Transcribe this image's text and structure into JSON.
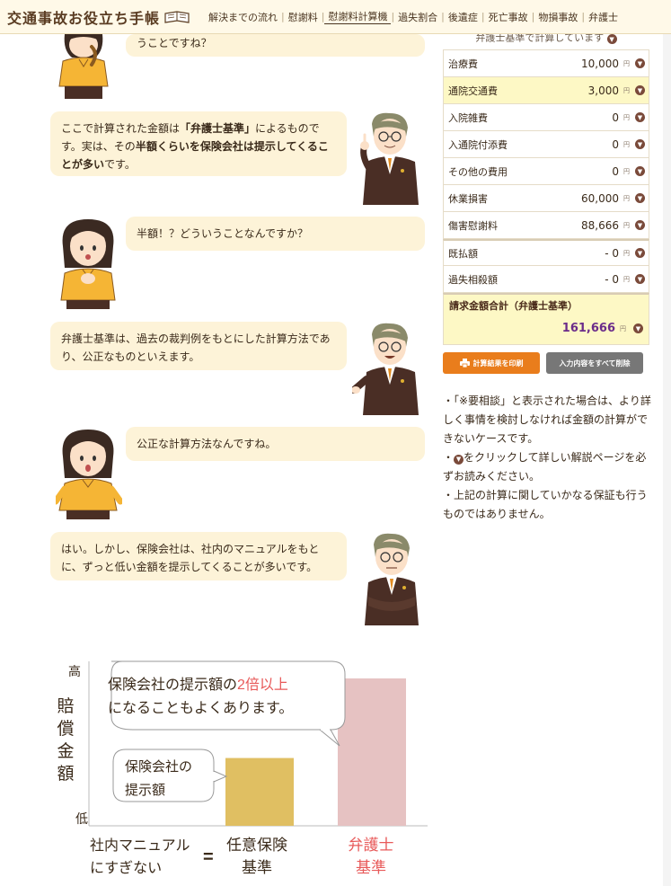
{
  "header": {
    "logo_text": "交通事故お役立ち手帳",
    "nav": [
      {
        "label": "解決までの流れ"
      },
      {
        "label": "慰謝料"
      },
      {
        "label": "慰謝料計算機"
      },
      {
        "label": "過失割合"
      },
      {
        "label": "後遺症"
      },
      {
        "label": "死亡事故"
      },
      {
        "label": "物損事故"
      },
      {
        "label": "弁護士"
      }
    ]
  },
  "conversation": {
    "msg1": "うことですね？",
    "msg2_pre": "ここで計算された金額は",
    "msg2_b1": "「弁護士基準」",
    "msg2_mid": "によるものです。実は、その",
    "msg2_b2": "半額くらいを保険会社は提示してくることが多い",
    "msg2_post": "です。",
    "msg3": "半額！？どういうことなんですか？",
    "msg4": "弁護士基準は、過去の裁判例をもとにした計算方法であり、公正なものといえます。",
    "msg5": "公正な計算方法なんですね。",
    "msg6": "はい。しかし、保険会社は、社内のマニュアルをもとに、ずっと低い金額を提示してくることが多いです。"
  },
  "chart_data": {
    "type": "bar",
    "categories": [
      "任意保険基準",
      "弁護士基準"
    ],
    "values": [
      0.46,
      1.0
    ],
    "ylabel": "賠償金額",
    "y_top_label": "高",
    "y_bottom_label": "低",
    "bar_colors": [
      "#e0bf62",
      "#e6c2c2"
    ],
    "callout_big_1": "保険会社の提示額の",
    "callout_big_emph": "2倍以上",
    "callout_big_2": "になることもよくあります。",
    "callout_small_1": "保険会社の",
    "callout_small_2": "提示額",
    "xlabel_left_1": "社内マニュアル",
    "xlabel_left_2": "にすぎない",
    "equals": "=",
    "cat1_line1": "任意保険",
    "cat1_line2": "基準",
    "cat2_line1": "弁護士",
    "cat2_line2": "基準",
    "emph_color": "#e85a5a"
  },
  "panel": {
    "top_note": "弁護士基準で計算しています",
    "unit": "円",
    "rows": [
      {
        "label": "治療費",
        "value": "10,000"
      },
      {
        "label": "通院交通費",
        "value": "3,000"
      },
      {
        "label": "入院雑費",
        "value": "0"
      },
      {
        "label": "入通院付添費",
        "value": "0"
      },
      {
        "label": "その他の費用",
        "value": "0"
      },
      {
        "label": "休業損害",
        "value": "60,000"
      },
      {
        "label": "傷害慰謝料",
        "value": "88,666"
      },
      {
        "label": "既払額",
        "value": "- 0"
      },
      {
        "label": "過失相殺額",
        "value": "- 0"
      }
    ],
    "total_label": "請求金額合計（弁護士基準）",
    "total_value": "161,666",
    "print_label": "計算結果を印刷",
    "clear_label": "入力内容をすべて削除",
    "notes": [
      "・「※要相談」と表示された場合は、より詳しく事情を検討しなければ金額の計算ができないケースです。",
      "・をクリックして詳しい解説ページを必ずお読みください。",
      "・上記の計算に関していかなる保証も行うものではありません。"
    ]
  }
}
